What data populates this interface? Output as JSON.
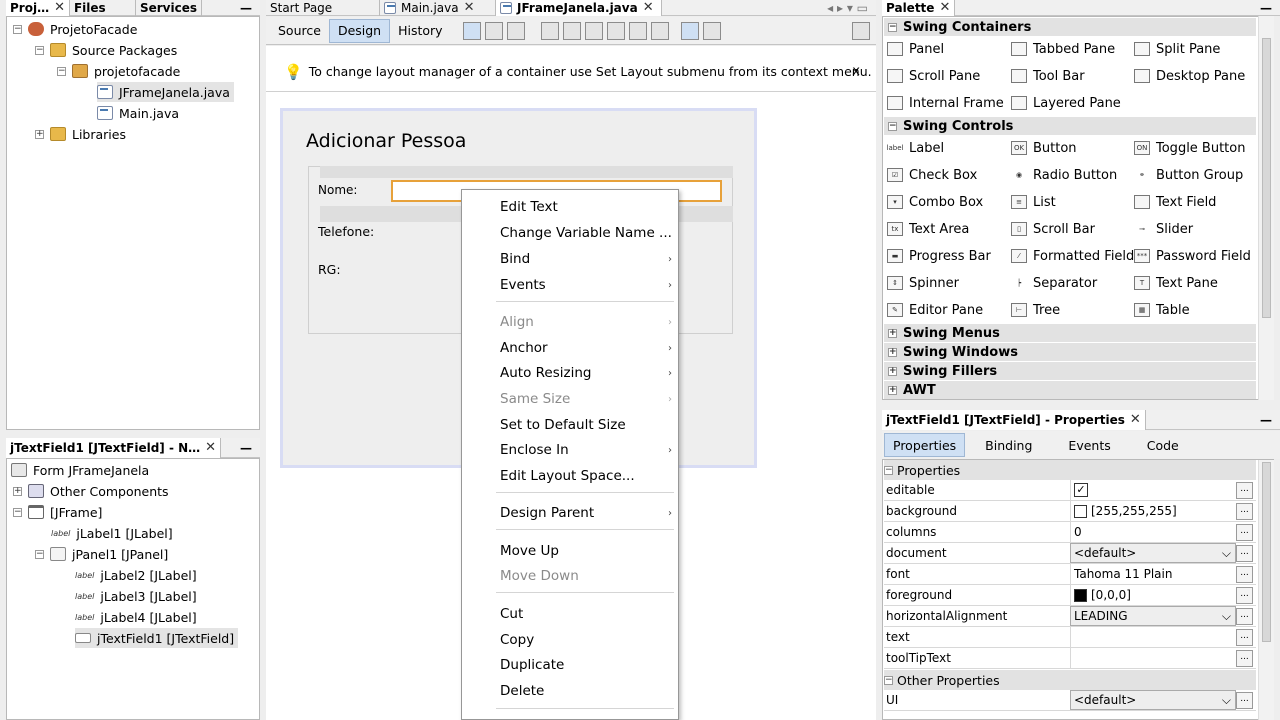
{
  "left_tabs": {
    "projects": "Proj…",
    "files": "Files",
    "services": "Services"
  },
  "project_tree": [
    {
      "label": "ProjetoFacade"
    },
    {
      "label": "Source Packages"
    },
    {
      "label": "projetofacade"
    },
    {
      "label": "JFrameJanela.java"
    },
    {
      "label": "Main.java"
    },
    {
      "label": "Libraries"
    }
  ],
  "navigator": {
    "title": "jTextField1 [JTextField] - N…",
    "items": [
      {
        "label": "Form JFrameJanela"
      },
      {
        "label": "Other Components"
      },
      {
        "label": "[JFrame]"
      },
      {
        "label": "jLabel1 [JLabel]"
      },
      {
        "label": "jPanel1 [JPanel]"
      },
      {
        "label": "jLabel2 [JLabel]"
      },
      {
        "label": "jLabel3 [JLabel]"
      },
      {
        "label": "jLabel4 [JLabel]"
      },
      {
        "label": "jTextField1 [JTextField]"
      }
    ]
  },
  "editor_tabs": [
    "Start Page",
    "Main.java",
    "JFrameJanela.java"
  ],
  "editor_toolbar": {
    "source": "Source",
    "design": "Design",
    "history": "History"
  },
  "hint": {
    "text": "To change layout manager of a container use Set Layout submenu from its context menu.",
    "close": "x"
  },
  "form": {
    "title": "Adicionar Pessoa",
    "label_nome": "Nome:",
    "label_telefone": "Telefone:",
    "label_rg": "RG:"
  },
  "context_menu": [
    {
      "label": "Edit Text"
    },
    {
      "label": "Change Variable Name ..."
    },
    {
      "label": "Bind",
      "arrow": "›"
    },
    {
      "label": "Events",
      "arrow": "›"
    },
    {
      "label": "Align",
      "arrow": "›"
    },
    {
      "label": "Anchor",
      "arrow": "›"
    },
    {
      "label": "Auto Resizing",
      "arrow": "›"
    },
    {
      "label": "Same Size",
      "arrow": "›"
    },
    {
      "label": "Set to Default Size"
    },
    {
      "label": "Enclose In",
      "arrow": "›"
    },
    {
      "label": "Edit Layout Space..."
    },
    {
      "label": "Design Parent",
      "arrow": "›"
    },
    {
      "label": "Move Up"
    },
    {
      "label": "Move Down"
    },
    {
      "label": "Cut"
    },
    {
      "label": "Copy"
    },
    {
      "label": "Duplicate"
    },
    {
      "label": "Delete"
    }
  ],
  "palette": {
    "title": "Palette",
    "containers": {
      "title": "Swing Containers",
      "items": [
        "Panel",
        "Tabbed Pane",
        "Split Pane",
        "Scroll Pane",
        "Tool Bar",
        "Desktop Pane",
        "Internal Frame",
        "Layered Pane"
      ]
    },
    "controls": {
      "title": "Swing Controls",
      "items": [
        "Label",
        "Button",
        "Toggle Button",
        "Check Box",
        "Radio Button",
        "Button Group",
        "Combo Box",
        "List",
        "Text Field",
        "Text Area",
        "Scroll Bar",
        "Slider",
        "Progress Bar",
        "Formatted Field",
        "Password Field",
        "Spinner",
        "Separator",
        "Text Pane",
        "Editor Pane",
        "Tree",
        "Table"
      ]
    },
    "collapsed": [
      "Swing Menus",
      "Swing Windows",
      "Swing Fillers",
      "AWT"
    ]
  },
  "properties": {
    "title": "jTextField1 [JTextField] - Properties",
    "tabs": [
      "Properties",
      "Binding",
      "Events",
      "Code"
    ],
    "section": "Properties",
    "rows": [
      {
        "name": "editable",
        "value": ""
      },
      {
        "name": "background",
        "value": "[255,255,255]",
        "color": "#ffffff"
      },
      {
        "name": "columns",
        "value": "0"
      },
      {
        "name": "document",
        "value": "<default>"
      },
      {
        "name": "font",
        "value": "Tahoma 11 Plain"
      },
      {
        "name": "foreground",
        "value": "[0,0,0]",
        "color": "#000000"
      },
      {
        "name": "horizontalAlignment",
        "value": "LEADING"
      },
      {
        "name": "text",
        "value": ""
      },
      {
        "name": "toolTipText",
        "value": ""
      }
    ],
    "other_section": "Other Properties",
    "other_rows": [
      {
        "name": "UI",
        "value": "<default>"
      }
    ],
    "ellipsis": "..."
  }
}
